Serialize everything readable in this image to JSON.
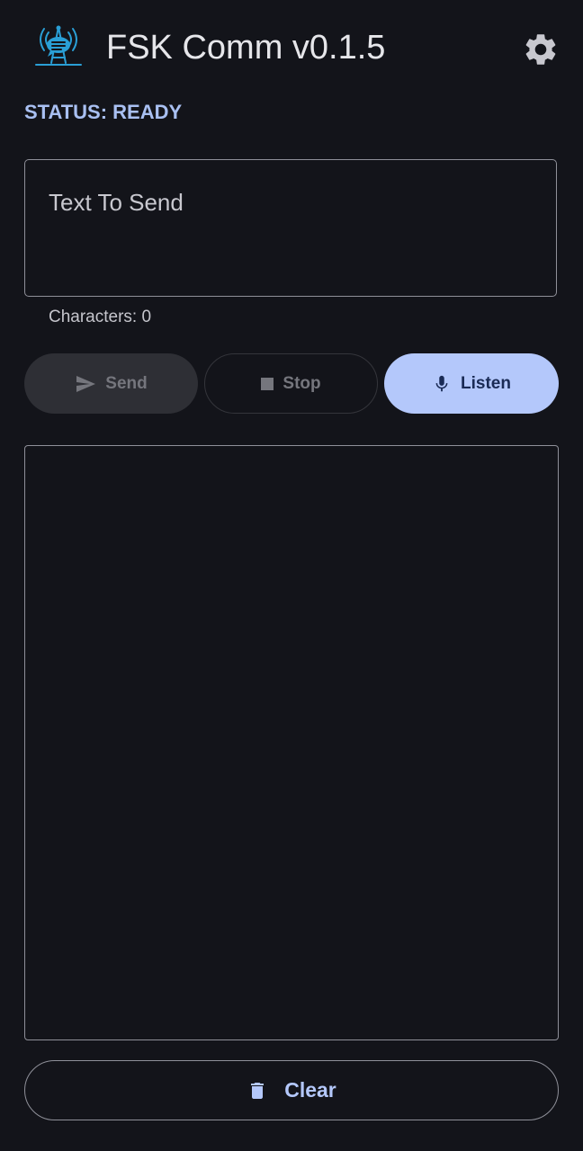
{
  "app": {
    "title": "FSK Comm v0.1.5",
    "logo_icon": "broadcast-tower-chat-icon",
    "settings_icon": "gear-icon"
  },
  "status": {
    "text": "STATUS: READY",
    "color": "#a9c0f2"
  },
  "input": {
    "placeholder": "Text To Send",
    "value": "",
    "character_count_label": "Characters: 0"
  },
  "controls": {
    "send": {
      "label": "Send",
      "icon": "send-icon",
      "enabled": false
    },
    "stop": {
      "label": "Stop",
      "icon": "stop-icon",
      "enabled": false
    },
    "listen": {
      "label": "Listen",
      "icon": "microphone-icon",
      "enabled": true
    }
  },
  "output": {
    "text": ""
  },
  "clear": {
    "label": "Clear",
    "icon": "trash-icon"
  },
  "colors": {
    "background": "#13141a",
    "accent": "#b4c8fb",
    "logo": "#2a9fd6",
    "outline": "#8f9099",
    "disabled_text": "#75767d"
  }
}
